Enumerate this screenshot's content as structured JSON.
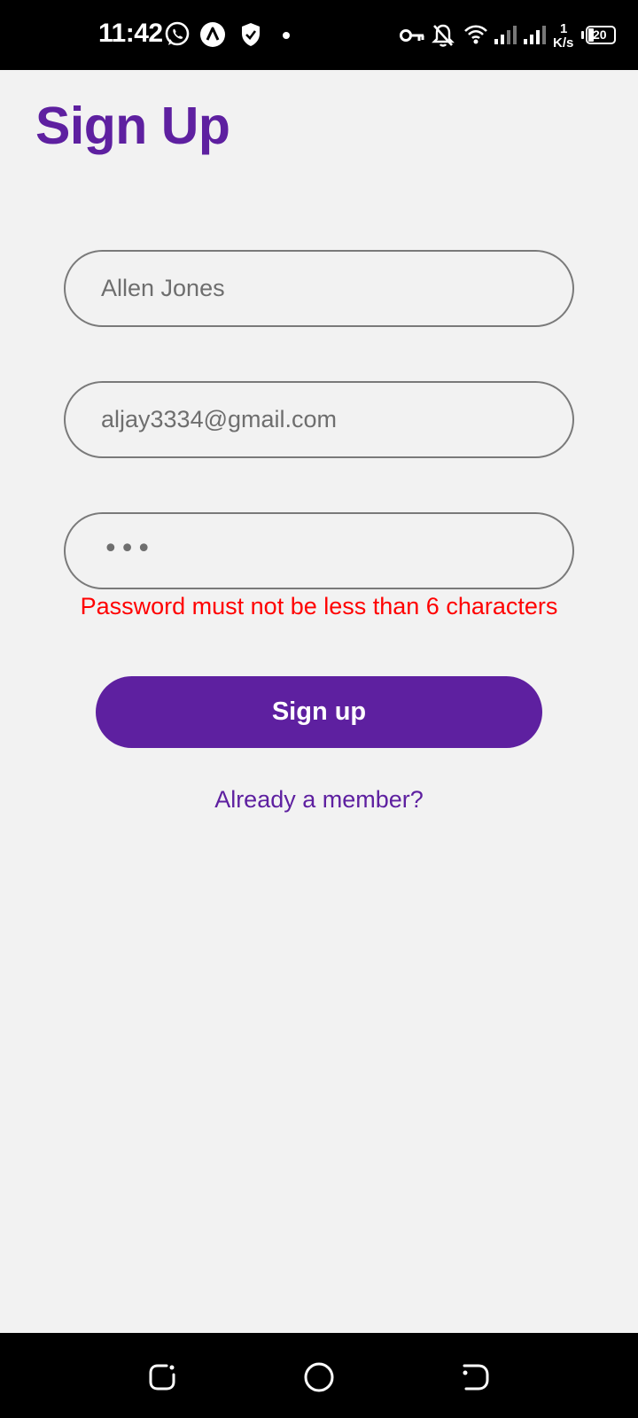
{
  "status_bar": {
    "time": "11:42",
    "net_speed_value": "1",
    "net_speed_unit": "K/s",
    "battery": "20",
    "icons": [
      "whatsapp-icon",
      "app-notification-icon",
      "shield-icon",
      "dot-icon",
      "vpn-key-icon",
      "bell-off-icon",
      "wifi-icon",
      "signal-icon",
      "signal-icon",
      "battery-icon"
    ]
  },
  "page": {
    "title": "Sign Up"
  },
  "form": {
    "name": {
      "value": "Allen Jones",
      "placeholder": ""
    },
    "email": {
      "value": "aljay3334@gmail.com",
      "placeholder": ""
    },
    "password": {
      "masked": "•••"
    },
    "error": "Password must not be less than 6 characters",
    "submit_label": "Sign up",
    "login_link": "Already a member?"
  },
  "nav_bar": {
    "icons": [
      "recent-apps-icon",
      "home-icon",
      "back-icon"
    ]
  },
  "colors": {
    "accent": "#5e20a0",
    "error": "#ff0000",
    "background": "#f2f2f2",
    "field_border": "#7a7a7a"
  }
}
